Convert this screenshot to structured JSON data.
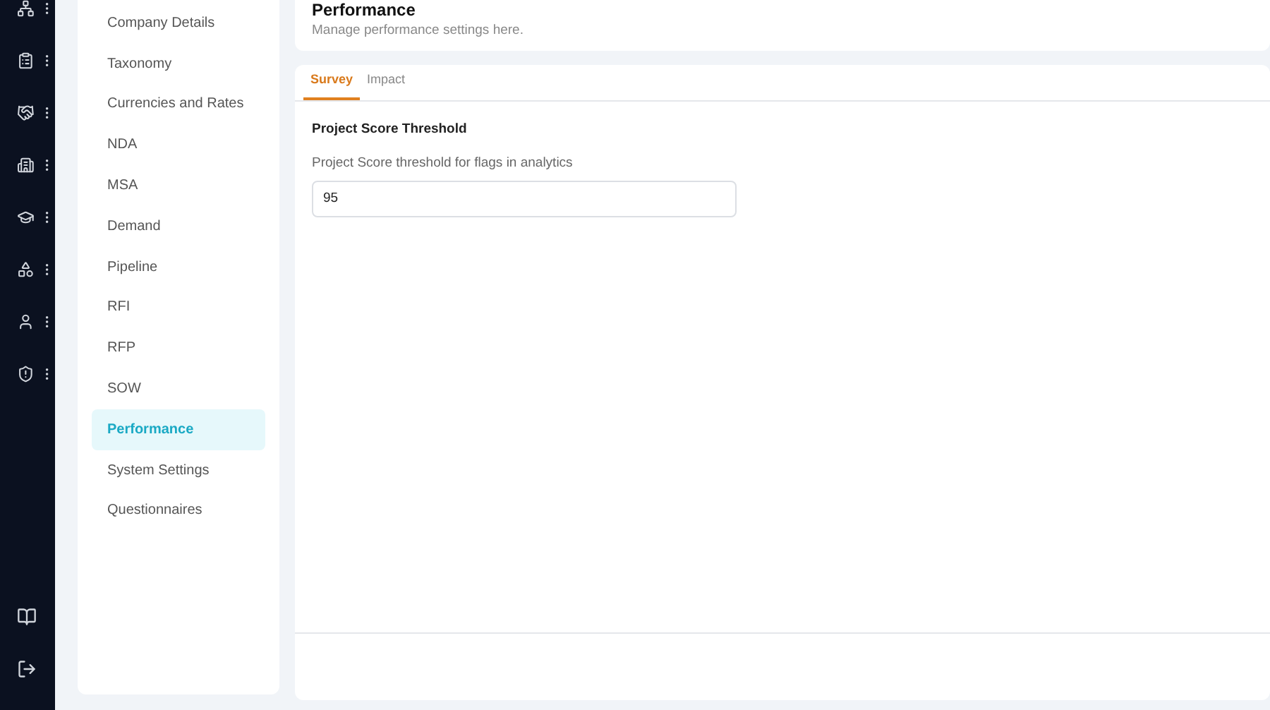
{
  "rail": {
    "items": [
      {
        "kind": "tree"
      },
      {
        "kind": "clipboard"
      },
      {
        "kind": "handshake"
      },
      {
        "kind": "building"
      },
      {
        "kind": "cap"
      },
      {
        "kind": "shapes"
      },
      {
        "kind": "user"
      },
      {
        "kind": "shield"
      }
    ],
    "bottom": [
      {
        "kind": "book"
      },
      {
        "kind": "logout"
      }
    ]
  },
  "sidebar": {
    "items": [
      {
        "label": "Company Details",
        "selected": false
      },
      {
        "label": "Taxonomy",
        "selected": false
      },
      {
        "label": "Currencies and Rates",
        "selected": false
      },
      {
        "label": "NDA",
        "selected": false
      },
      {
        "label": "MSA",
        "selected": false
      },
      {
        "label": "Demand",
        "selected": false
      },
      {
        "label": "Pipeline",
        "selected": false
      },
      {
        "label": "RFI",
        "selected": false
      },
      {
        "label": "RFP",
        "selected": false
      },
      {
        "label": "SOW",
        "selected": false
      },
      {
        "label": "Performance",
        "selected": true
      },
      {
        "label": "System Settings",
        "selected": false
      },
      {
        "label": "Questionnaires",
        "selected": false
      }
    ]
  },
  "header": {
    "title": "Performance",
    "subtitle": "Manage performance settings here."
  },
  "tabs": [
    {
      "label": "Survey",
      "selected": true
    },
    {
      "label": "Impact",
      "selected": false
    }
  ],
  "section": {
    "title": "Project Score Threshold",
    "field_label": "Project Score threshold for flags in analytics",
    "value": "95"
  }
}
